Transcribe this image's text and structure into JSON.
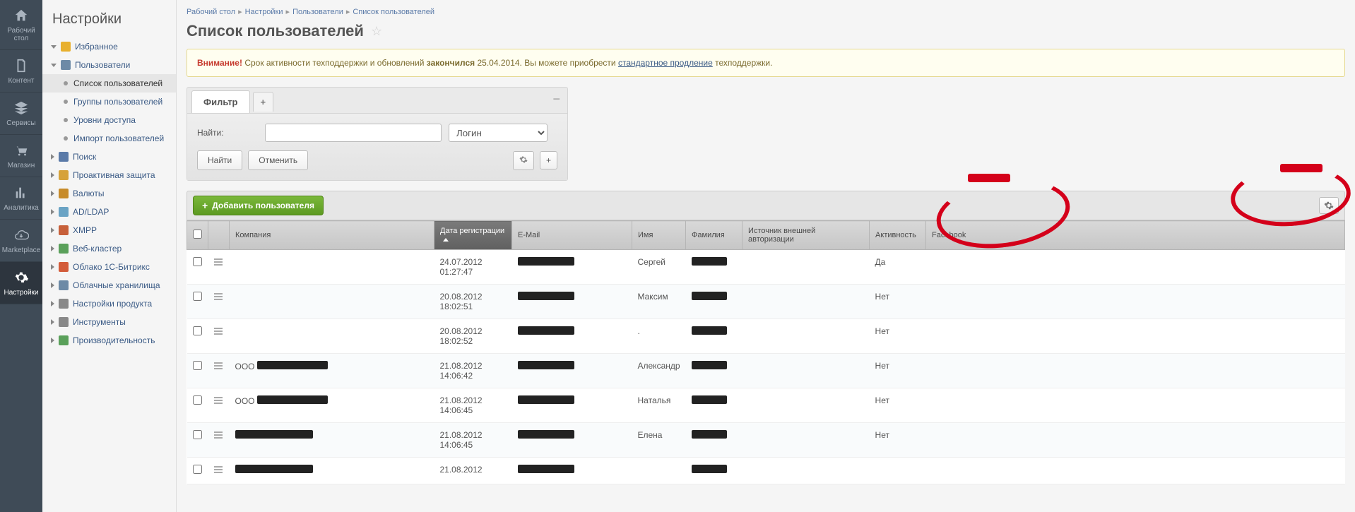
{
  "nav": [
    {
      "key": "desktop",
      "label": "Рабочий стол",
      "icon": "home"
    },
    {
      "key": "content",
      "label": "Контент",
      "icon": "doc"
    },
    {
      "key": "services",
      "label": "Сервисы",
      "icon": "stack"
    },
    {
      "key": "store",
      "label": "Магазин",
      "icon": "cart"
    },
    {
      "key": "analytics",
      "label": "Аналитика",
      "icon": "bars"
    },
    {
      "key": "marketplace",
      "label": "Marketplace",
      "icon": "cloud"
    },
    {
      "key": "settings",
      "label": "Настройки",
      "icon": "gear",
      "active": true
    }
  ],
  "sidebar": {
    "title": "Настройки",
    "items": [
      {
        "label": "Избранное",
        "icon": "star",
        "caret": "down"
      },
      {
        "label": "Пользователи",
        "icon": "user",
        "caret": "down",
        "expanded": true
      },
      {
        "label": "Список пользователей",
        "sub": true,
        "active": true
      },
      {
        "label": "Группы пользователей",
        "sub": true
      },
      {
        "label": "Уровни доступа",
        "sub": true
      },
      {
        "label": "Импорт пользователей",
        "sub": true
      },
      {
        "label": "Поиск",
        "icon": "search",
        "caret": "right"
      },
      {
        "label": "Проактивная защита",
        "icon": "shield",
        "caret": "right"
      },
      {
        "label": "Валюты",
        "icon": "currency",
        "caret": "right"
      },
      {
        "label": "AD/LDAP",
        "icon": "ad",
        "caret": "right"
      },
      {
        "label": "XMPP",
        "icon": "xmpp",
        "caret": "right"
      },
      {
        "label": "Веб-кластер",
        "icon": "cluster",
        "caret": "right"
      },
      {
        "label": "Облако 1С-Битрикс",
        "icon": "cloud1c",
        "caret": "right"
      },
      {
        "label": "Облачные хранилища",
        "icon": "cloudstore",
        "caret": "right"
      },
      {
        "label": "Настройки продукта",
        "icon": "wrench",
        "caret": "right"
      },
      {
        "label": "Инструменты",
        "icon": "tools",
        "caret": "right"
      },
      {
        "label": "Производительность",
        "icon": "speed",
        "caret": "right"
      }
    ]
  },
  "breadcrumb": [
    "Рабочий стол",
    "Настройки",
    "Пользователи",
    "Список пользователей"
  ],
  "page": {
    "title": "Список пользователей"
  },
  "alert": {
    "warn": "Внимание!",
    "t1": " Срок активности техподдержки и обновлений ",
    "bold": "закончился",
    "t2": " 25.04.2014. Вы можете приобрести ",
    "link": "стандартное продление",
    "t3": " техподдержки."
  },
  "filter": {
    "tab": "Фильтр",
    "find_label": "Найти:",
    "select": "Логин",
    "btn_find": "Найти",
    "btn_cancel": "Отменить",
    "input_value": "",
    "input_placeholder": ""
  },
  "toolbar": {
    "add": "Добавить пользователя"
  },
  "columns": {
    "company": "Компания",
    "regdate": "Дата регистрации",
    "email": "E-Mail",
    "name": "Имя",
    "surname": "Фамилия",
    "authsrc": "Источник внешней авторизации",
    "activity": "Активность",
    "facebook": "Facebook"
  },
  "rows": [
    {
      "company": "",
      "regdate": "24.07.2012 01:27:47",
      "name": "Сергей",
      "activity": "Да"
    },
    {
      "company": "",
      "regdate": "20.08.2012 18:02:51",
      "name": "Максим",
      "activity": "Нет"
    },
    {
      "company": "",
      "regdate": "20.08.2012 18:02:52",
      "name": ".",
      "activity": "Нет"
    },
    {
      "company": "ООО ",
      "regdate": "21.08.2012 14:06:42",
      "name": "Александр",
      "activity": "Нет",
      "redactCompany": true
    },
    {
      "company": "ООО ",
      "regdate": "21.08.2012 14:06:45",
      "name": "Наталья",
      "activity": "Нет",
      "redactCompany": true
    },
    {
      "company": "",
      "regdate": "21.08.2012 14:06:45",
      "name": "Елена",
      "activity": "Нет",
      "redactCompany": true,
      "redactCompanyFull": true
    },
    {
      "company": "",
      "regdate": "21.08.2012",
      "name": "",
      "activity": "",
      "redactCompany": true,
      "redactCompanyFull": true
    }
  ]
}
